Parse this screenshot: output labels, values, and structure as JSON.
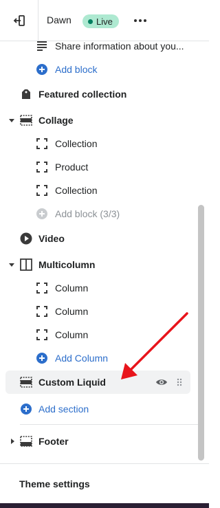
{
  "topbar": {
    "exit_icon": "exit-icon",
    "theme_name": "Dawn",
    "badge": "Live",
    "badge_color": "#aee9d1",
    "more_icon": "more-horizontal-icon"
  },
  "tree": {
    "share_info": "Share information about you...",
    "add_block_1": "Add block",
    "featured_collection": "Featured collection",
    "collage": "Collage",
    "collage_items": [
      "Collection",
      "Product",
      "Collection"
    ],
    "add_block_disabled": "Add block (3/3)",
    "video": "Video",
    "multicolumn": "Multicolumn",
    "multicolumn_items": [
      "Column",
      "Column",
      "Column"
    ],
    "add_column": "Add Column",
    "custom_liquid": "Custom Liquid",
    "add_section": "Add section",
    "footer": "Footer"
  },
  "bottom": {
    "theme_settings": "Theme settings"
  },
  "colors": {
    "accent_blue": "#2c6ecb",
    "arrow_red": "#e8141b",
    "selected_bg": "#f1f2f3"
  }
}
